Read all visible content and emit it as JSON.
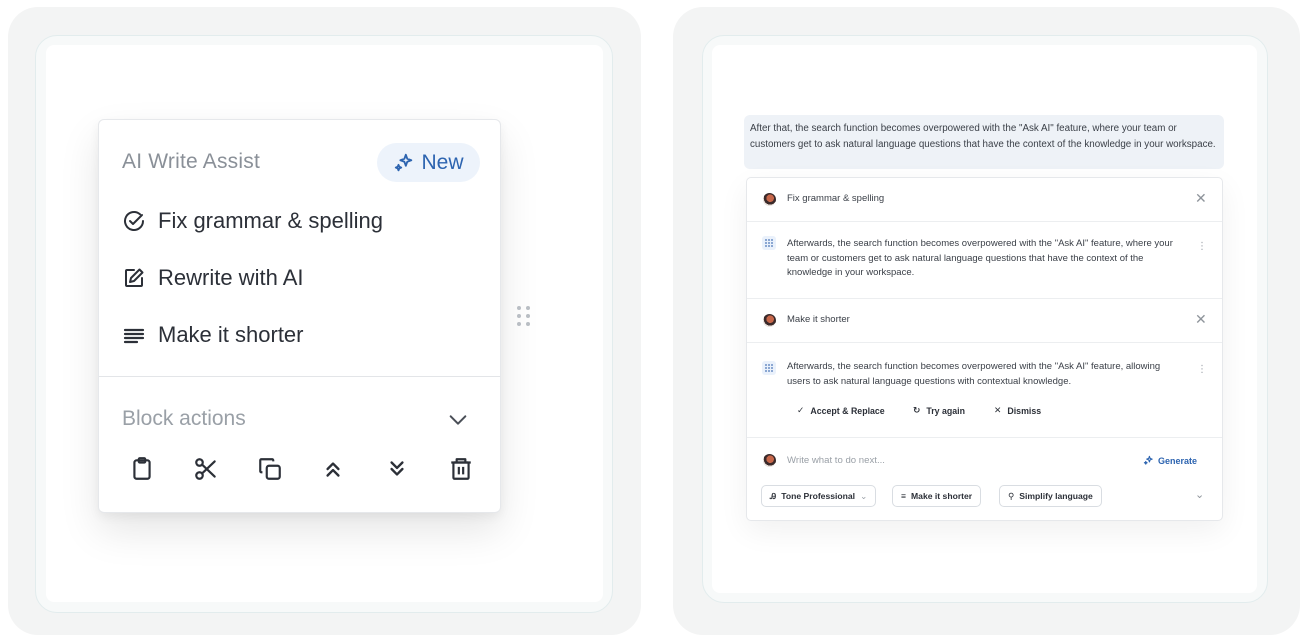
{
  "left": {
    "menu_title": "AI Write Assist",
    "badge": "New",
    "items": [
      {
        "label": "Fix grammar & spelling",
        "icon": "check-circle-icon"
      },
      {
        "label": "Rewrite with AI",
        "icon": "edit-icon"
      },
      {
        "label": "Make it shorter",
        "icon": "shorten-lines-icon"
      }
    ],
    "block_actions_title": "Block actions",
    "block_action_icons": [
      "clipboard-icon",
      "scissors-icon",
      "copy-icon",
      "move-up-icon",
      "move-down-icon",
      "trash-icon"
    ]
  },
  "right": {
    "quote": "After that, the search function becomes overpowered with the \"Ask AI\" feature, where your team or customers get to ask natural language questions that have the context of the knowledge in your workspace.",
    "prompt1": "Fix grammar & spelling",
    "response1": "Afterwards, the search function becomes overpowered with the \"Ask AI\" feature, where your team or customers get to ask natural language questions that have the context of the knowledge in your workspace.",
    "prompt2": "Make it shorter",
    "response2": "Afterwards, the search function becomes overpowered with the \"Ask AI\" feature, allowing users to ask natural language questions with contextual knowledge.",
    "actions": {
      "accept": "Accept & Replace",
      "try_again": "Try again",
      "dismiss": "Dismiss"
    },
    "input_placeholder": "Write what to do next...",
    "generate": "Generate",
    "chips": [
      {
        "label": "Tone Professional",
        "icon": "tone-icon"
      },
      {
        "label": "Make it shorter",
        "icon": "shorten-lines-icon"
      },
      {
        "label": "Simplify language",
        "icon": "magic-wand-icon"
      }
    ],
    "colors": {
      "accent": "#2d64b0",
      "badge_bg": "#edf3fb",
      "quote_bg": "#eef2f7"
    }
  }
}
